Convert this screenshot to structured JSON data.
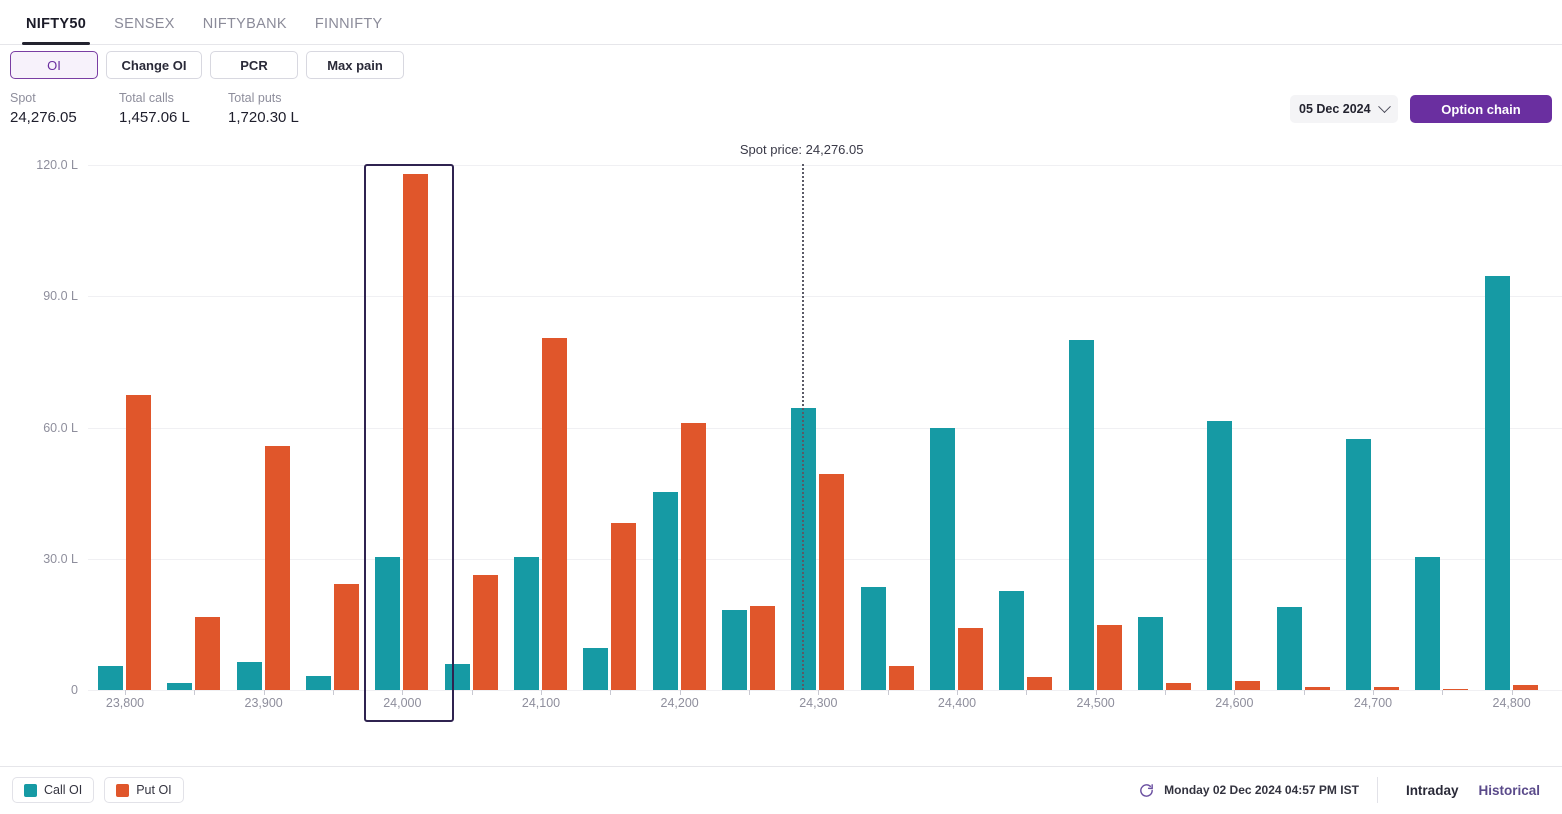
{
  "tabs": [
    {
      "label": "NIFTY50",
      "active": true
    },
    {
      "label": "SENSEX",
      "active": false
    },
    {
      "label": "NIFTYBANK",
      "active": false
    },
    {
      "label": "FINNIFTY",
      "active": false
    }
  ],
  "chips": [
    {
      "label": "OI",
      "active": true
    },
    {
      "label": "Change OI",
      "active": false
    },
    {
      "label": "PCR",
      "active": false
    },
    {
      "label": "Max pain",
      "active": false
    }
  ],
  "date_selector": {
    "value": "05 Dec 2024",
    "icon": "chevron-down-icon"
  },
  "option_chain_button": {
    "label": "Option chain"
  },
  "stats": [
    {
      "label": "Spot",
      "value": "24,276.05"
    },
    {
      "label": "Total calls",
      "value": "1,457.06 L"
    },
    {
      "label": "Total puts",
      "value": "1,720.30 L"
    }
  ],
  "legend": [
    {
      "label": "Call OI",
      "color": "#169AA4"
    },
    {
      "label": "Put OI",
      "color": "#E0562B"
    }
  ],
  "footer": {
    "refresh_icon": "refresh-icon",
    "timestamp": "Monday 02 Dec 2024 04:57 PM IST",
    "links": [
      {
        "label": "Intraday",
        "active": true
      },
      {
        "label": "Historical",
        "active": false
      }
    ]
  },
  "chart_data": {
    "type": "bar",
    "title": "",
    "xlabel": "",
    "ylabel": "",
    "ylim": [
      0,
      120
    ],
    "yticks": [
      0,
      30,
      60,
      90,
      120
    ],
    "ytick_labels": [
      "0",
      "30.0 L",
      "60.0 L",
      "90.0 L",
      "120.0 L"
    ],
    "grid": true,
    "legend_position": "bottom-left",
    "unit": "L",
    "categories": [
      "23,800",
      "23,850",
      "23,900",
      "23,950",
      "24,000",
      "24,050",
      "24,100",
      "24,150",
      "24,200",
      "24,250",
      "24,300",
      "24,350",
      "24,400",
      "24,450",
      "24,500",
      "24,550",
      "24,600",
      "24,650",
      "24,700",
      "24,750",
      "24,800"
    ],
    "tick_labels": [
      "23,800",
      "",
      "23,900",
      "",
      "24,000",
      "",
      "24,100",
      "",
      "24,200",
      "",
      "24,300",
      "",
      "24,400",
      "",
      "24,500",
      "",
      "24,600",
      "",
      "24,700",
      "",
      "24,800"
    ],
    "series": [
      {
        "name": "Call OI",
        "color": "#169AA4",
        "values": [
          5.6,
          1.7,
          6.4,
          3.1,
          30.3,
          5.9,
          30.4,
          9.6,
          45.2,
          18.4,
          64.5,
          23.6,
          60.0,
          22.7,
          79.9,
          16.6,
          61.4,
          18.9,
          57.3,
          30.4,
          94.6
        ]
      },
      {
        "name": "Put OI",
        "color": "#E0562B",
        "values": [
          67.4,
          16.6,
          55.8,
          24.3,
          118.0,
          26.4,
          80.5,
          38.2,
          61.1,
          19.3,
          49.3,
          5.5,
          14.1,
          2.9,
          14.8,
          1.7,
          2.0,
          0.6,
          0.7,
          0.3,
          1.1
        ]
      }
    ],
    "annotations": [
      {
        "type": "spot-line",
        "label": "Spot price: 24,276.05",
        "value": 24276.05
      },
      {
        "type": "highlight",
        "category": "24,000"
      }
    ]
  }
}
